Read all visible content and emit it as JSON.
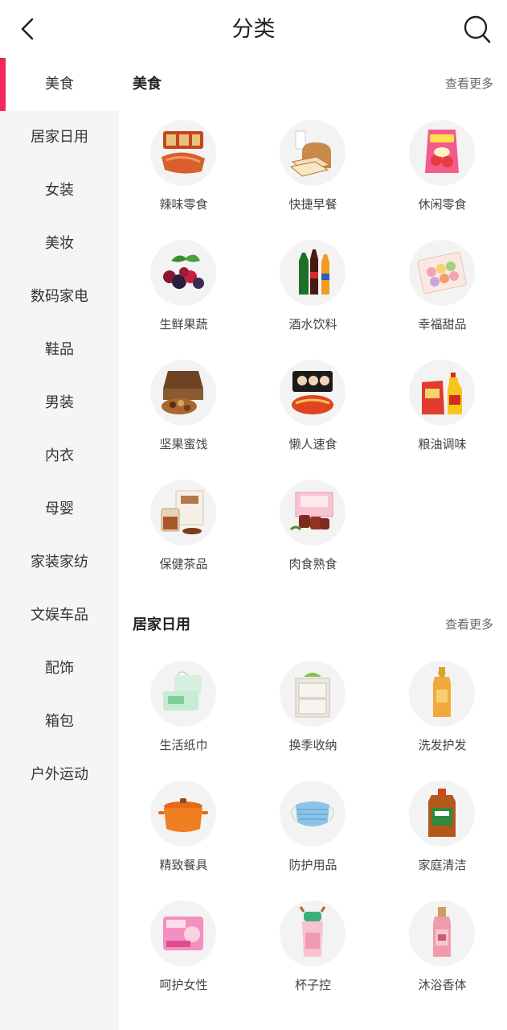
{
  "header": {
    "title": "分类",
    "back_icon": "chevron-left-icon",
    "search_icon": "search-icon"
  },
  "colors": {
    "accent": "#f0285a",
    "sidebar_bg": "#f5f5f5",
    "thumb_bg": "#f3f3f3"
  },
  "sidebar": {
    "items": [
      {
        "label": "美食",
        "active": true
      },
      {
        "label": "居家日用"
      },
      {
        "label": "女装"
      },
      {
        "label": "美妆"
      },
      {
        "label": "数码家电"
      },
      {
        "label": "鞋品"
      },
      {
        "label": "男装"
      },
      {
        "label": "内衣"
      },
      {
        "label": "母婴"
      },
      {
        "label": "家装家纺"
      },
      {
        "label": "文娱车品"
      },
      {
        "label": "配饰"
      },
      {
        "label": "箱包"
      },
      {
        "label": "户外运动"
      }
    ]
  },
  "sections": [
    {
      "title": "美食",
      "more": "查看更多",
      "items": [
        {
          "label": "辣味零食",
          "icon": "spicy-snack-icon"
        },
        {
          "label": "快捷早餐",
          "icon": "bread-icon"
        },
        {
          "label": "休闲零食",
          "icon": "chips-bag-icon"
        },
        {
          "label": "生鲜果蔬",
          "icon": "berries-icon"
        },
        {
          "label": "酒水饮料",
          "icon": "bottles-icon"
        },
        {
          "label": "幸福甜品",
          "icon": "macaron-box-icon"
        },
        {
          "label": "坚果蜜饯",
          "icon": "nuts-box-icon"
        },
        {
          "label": "懒人速食",
          "icon": "instant-noodle-icon"
        },
        {
          "label": "粮油调味",
          "icon": "oil-rice-icon"
        },
        {
          "label": "保健茶品",
          "icon": "tea-box-icon"
        },
        {
          "label": "肉食熟食",
          "icon": "meat-box-icon"
        }
      ]
    },
    {
      "title": "居家日用",
      "more": "查看更多",
      "items": [
        {
          "label": "生活纸巾",
          "icon": "tissue-icon"
        },
        {
          "label": "换季收纳",
          "icon": "storage-drawer-icon"
        },
        {
          "label": "洗发护发",
          "icon": "shampoo-bottle-icon"
        },
        {
          "label": "精致餐具",
          "icon": "cooking-pot-icon"
        },
        {
          "label": "防护用品",
          "icon": "face-mask-icon"
        },
        {
          "label": "家庭清洁",
          "icon": "disinfectant-bottle-icon"
        },
        {
          "label": "呵护女性",
          "icon": "sanitary-pad-icon"
        },
        {
          "label": "杯子控",
          "icon": "water-cup-icon"
        },
        {
          "label": "沐浴香体",
          "icon": "perfume-mist-icon"
        }
      ]
    }
  ]
}
